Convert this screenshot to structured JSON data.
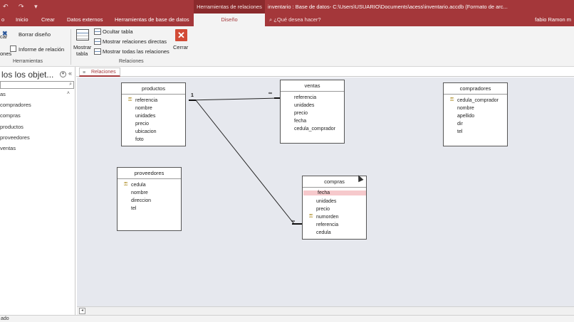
{
  "titlebar": {
    "quick_access": "↶ ↷ ▾",
    "context_header": "Herramientas de relaciones",
    "document_title": "inventario : Base de datos- C:\\Users\\USUARIO\\Documents\\acess\\inventario.accdb (Formato de arc..."
  },
  "tabs": {
    "archivo": "o",
    "inicio": "Inicio",
    "crear": "Crear",
    "datos_externos": "Datos externos",
    "herramientas_bd": "Herramientas de base de datos",
    "diseno": "Diseño",
    "tell_me": "⌕ ¿Qué desea hacer?",
    "user": "fabio Ramon m"
  },
  "ribbon": {
    "cut_label_1": "car",
    "cut_label_2": "ones",
    "borrar_diseno": "Borrar diseño",
    "informe_relacion": "Informe de relación",
    "herramientas_group": "Herramientas",
    "mostrar_tabla_1": "Mostrar",
    "mostrar_tabla_2": "tabla",
    "ocultar_tabla": "Ocultar tabla",
    "mostrar_relaciones_directas": "Mostrar relaciones directas",
    "mostrar_todas_relaciones": "Mostrar todas las relaciones",
    "cerrar": "Cerrar",
    "relaciones_group": "Relaciones"
  },
  "nav": {
    "title": "los los objet...",
    "group": "as",
    "items": [
      "compradores",
      "compras",
      "productos",
      "proveedores",
      "ventas"
    ]
  },
  "doctab": {
    "label": "Relaciones"
  },
  "status": {
    "text": "ado"
  },
  "tables": {
    "productos": {
      "title": "productos",
      "fields": [
        "referencia",
        "nombre",
        "unidades",
        "precio",
        "ubicacion",
        "foto"
      ]
    },
    "ventas": {
      "title": "ventas",
      "fields": [
        "referencia",
        "unidades",
        "precio",
        "fecha",
        "cedula_comprador"
      ]
    },
    "compradores": {
      "title": "compradores",
      "fields": [
        "cedula_comprador",
        "nombre",
        "apellido",
        "dir",
        "tel"
      ]
    },
    "proveedores": {
      "title": "proveedores",
      "fields": [
        "cedula",
        "nombre",
        "direccion",
        "tel"
      ]
    },
    "compras": {
      "title": "compras",
      "fields": [
        "fecha",
        "unidades",
        "precio",
        "numorden",
        "referencia",
        "cedula"
      ]
    }
  },
  "relations": {
    "one": "1",
    "many": "∞"
  },
  "colors": {
    "accent": "#a4373a",
    "canvas": "#e6e8ee",
    "selected_field": "#f6c9cc"
  }
}
